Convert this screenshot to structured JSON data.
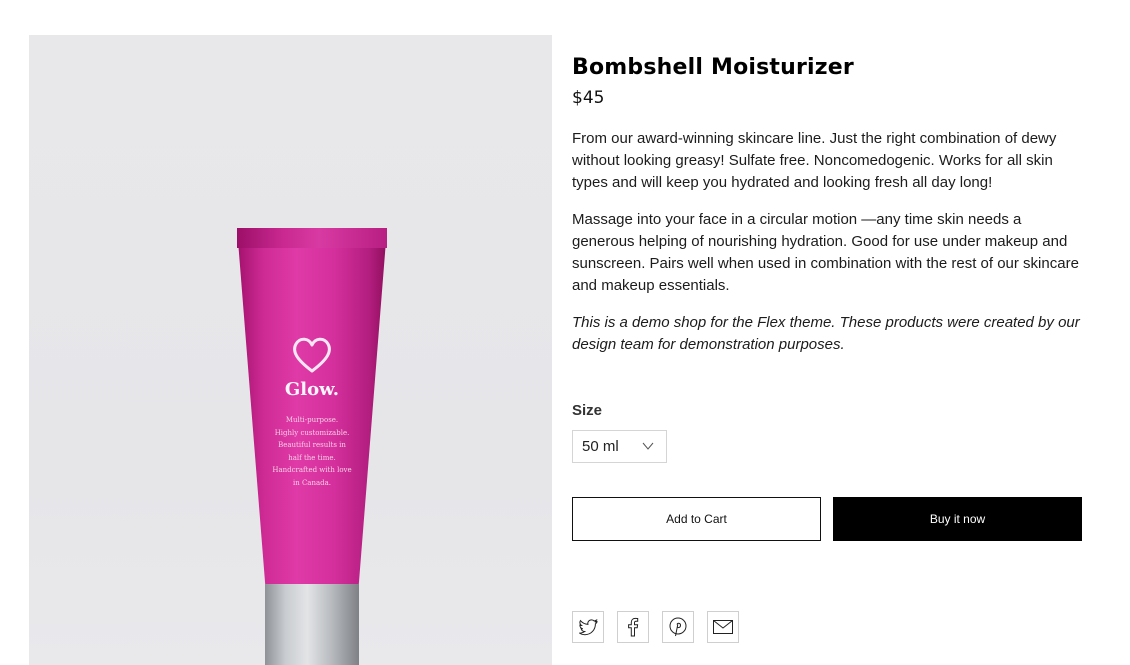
{
  "product": {
    "title": "Bombshell Moisturizer",
    "price": "$45",
    "description": [
      "From our award-winning skincare line. Just the right combination of dewy without looking greasy! Sulfate free. Noncomedogenic. Works for all skin types and will keep you hydrated and looking fresh all day long!",
      "Massage into your face in a circular motion —any time skin needs a generous helping of nourishing hydration. Good for use under makeup and sunscreen. Pairs well when used in combination with the rest of our skincare and makeup essentials."
    ],
    "note": "This is a demo shop for the Flex theme. These products were created by our design team for demonstration purposes."
  },
  "image": {
    "brand": "Glow.",
    "tagline": [
      "Multi-purpose.",
      "Highly customizable.",
      "Beautiful results in",
      "half the time.",
      "Handcrafted with love",
      "in Canada."
    ],
    "tube_color": "#d42f9c",
    "cap_color": "#c9ccd0"
  },
  "options": {
    "size_label": "Size",
    "size_value": "50 ml"
  },
  "actions": {
    "add_to_cart": "Add to Cart",
    "buy_now": "Buy it now"
  },
  "share": {
    "icons": [
      "twitter-icon",
      "facebook-icon",
      "pinterest-icon",
      "email-icon"
    ]
  },
  "colors": {
    "primary_button": "#000000",
    "text": "#111111"
  }
}
